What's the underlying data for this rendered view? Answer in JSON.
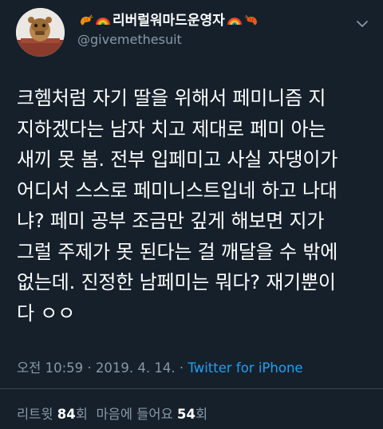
{
  "author": {
    "display_name": "리버럴워마드운영자",
    "username": "@givemethesuit",
    "name_emojis_left": [
      "shrimp-icon",
      "rainbow-icon"
    ],
    "name_emojis_right": [
      "rainbow-icon",
      "shrimp-icon"
    ]
  },
  "tweet": {
    "text": "크헴처럼 자기 딸을 위해서 페미니즘 지\n지하겠다는 남자 치고 제대로 페미 아는\n새끼 못 봄. 전부 입페미고 사실 자댕이가\n어디서 스스로 페미니스트입네 하고 나대\n냐? 페미 공부 조금만 깊게 해보면 지가\n그럴 주제가 못 된다는 걸 깨달을 수 밖에\n없는데. 진정한 남페미는 뭐다? 재기뿐이\n다 ㅇㅇ"
  },
  "meta": {
    "time": "오전 10:59",
    "separator1": " · ",
    "date": "2019. 4. 14.",
    "separator2": " · ",
    "source": "Twitter for iPhone"
  },
  "stats": {
    "retweets_label": "리트윗",
    "retweets_count": "84",
    "retweets_unit": "회",
    "likes_label": "마음에 들어요",
    "likes_count": "54",
    "likes_unit": "회"
  },
  "colors": {
    "background": "#15202b",
    "secondary_text": "#8899a6",
    "link": "#1da1f2",
    "divider": "#38444d"
  }
}
